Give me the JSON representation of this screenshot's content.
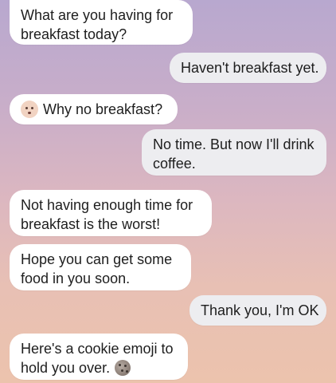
{
  "messages": [
    {
      "from": "bot",
      "lines": [
        "What are you having for",
        "breakfast today?"
      ]
    },
    {
      "from": "user",
      "lines": [
        "Haven't breakfast yet."
      ]
    },
    {
      "from": "bot",
      "lines": [
        "Why no breakfast?"
      ],
      "icon": "worried-face-emoji"
    },
    {
      "from": "user",
      "lines": [
        "No time. But now I'll drink",
        "coffee."
      ]
    },
    {
      "from": "bot",
      "lines": [
        "Not having enough time for",
        "breakfast is the worst!"
      ]
    },
    {
      "from": "bot",
      "lines": [
        "Hope you can get some",
        "food in you soon."
      ]
    },
    {
      "from": "user",
      "lines": [
        "Thank you, I'm OK"
      ]
    },
    {
      "from": "bot",
      "lines": [
        "Here's a cookie emoji to",
        "hold you over."
      ],
      "icon": "cookie-emoji"
    }
  ],
  "colors": {
    "bot_bubble": "#ffffff",
    "user_bubble": "#ededf0",
    "text": "#1e1e1e"
  }
}
